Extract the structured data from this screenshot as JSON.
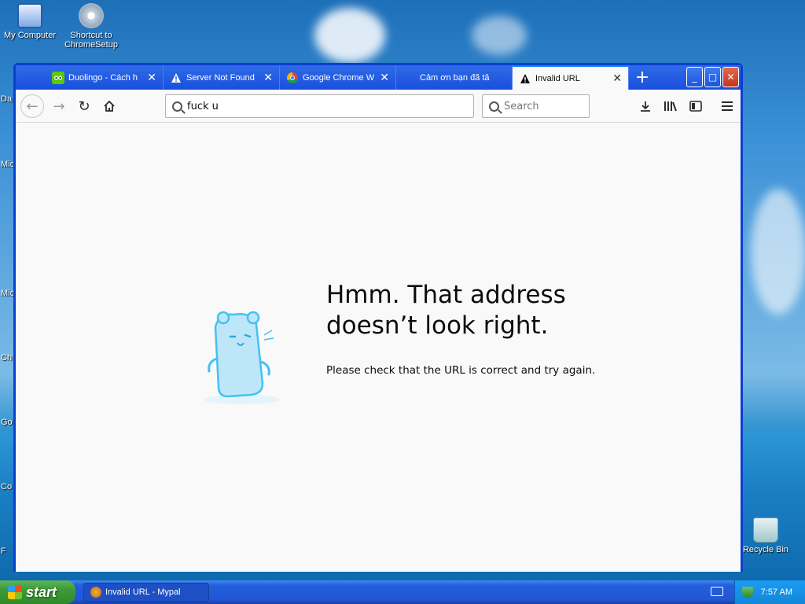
{
  "desktop": {
    "icons": [
      {
        "label": "My Computer",
        "icon": "my-computer-icon"
      },
      {
        "label": "Shortcut to ChromeSetup",
        "icon": "chrome-setup-icon"
      },
      {
        "label": "Recycle Bin",
        "icon": "recycle-bin-icon"
      }
    ],
    "edge_labels": [
      "Da",
      "Mic",
      "Mic",
      "Ch",
      "Go",
      "Co",
      "F"
    ]
  },
  "browser": {
    "tabs": [
      {
        "label": "Duolingo - Cách h",
        "icon": "duolingo-icon",
        "active": false
      },
      {
        "label": "Server Not Found",
        "icon": "warning-icon",
        "active": false
      },
      {
        "label": "Google Chrome W",
        "icon": "chrome-icon",
        "active": false
      },
      {
        "label": "Cảm ơn bạn đã tả",
        "icon": "",
        "active": false
      },
      {
        "label": "Invalid URL",
        "icon": "warning-icon",
        "active": true
      }
    ],
    "new_tab_label": "+",
    "window_buttons": {
      "minimize": "_",
      "maximize": "□",
      "close": "✕"
    },
    "url_value": "fuck u",
    "search_placeholder": "Search"
  },
  "error_page": {
    "title": "Hmm. That address doesn’t look right.",
    "description": "Please check that the URL is correct and try again."
  },
  "taskbar": {
    "start_label": "start",
    "task_item_label": "Invalid URL - Mypal",
    "clock": "7:57 AM"
  },
  "colors": {
    "tabstrip": "#1a4fdc",
    "active_tab_accent": "#0a84ff",
    "page_background": "#f9f9fa",
    "mascot": "#45c1f1"
  }
}
